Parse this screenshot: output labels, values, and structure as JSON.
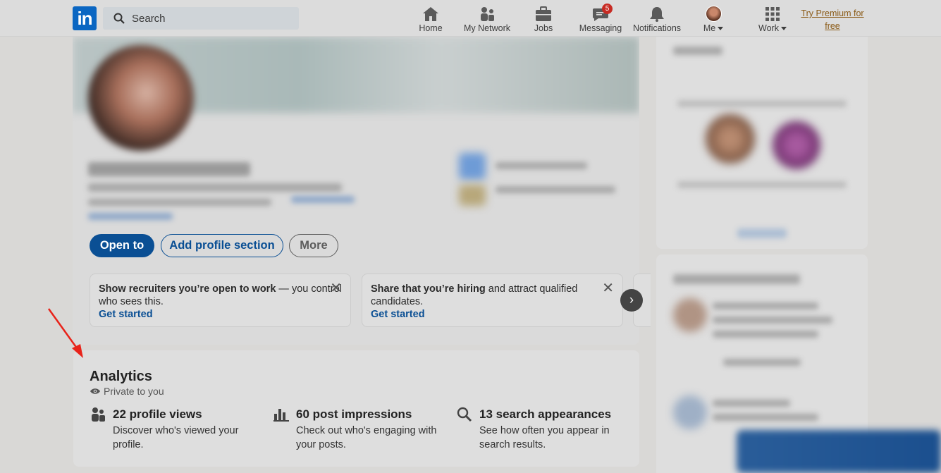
{
  "nav": {
    "logo_text": "in",
    "search_placeholder": "Search",
    "items": [
      {
        "label": "Home",
        "icon": "home-icon"
      },
      {
        "label": "My Network",
        "icon": "network-icon"
      },
      {
        "label": "Jobs",
        "icon": "briefcase-icon"
      },
      {
        "label": "Messaging",
        "icon": "messaging-icon",
        "badge": "5"
      },
      {
        "label": "Notifications",
        "icon": "bell-icon"
      },
      {
        "label": "Me",
        "icon": "avatar"
      },
      {
        "label": "Work",
        "icon": "grid-icon"
      }
    ],
    "premium_line1": "Try Premium for",
    "premium_line2": "free"
  },
  "profile": {
    "buttons": {
      "open_to": "Open to",
      "add_section": "Add profile section",
      "more": "More"
    },
    "suggestions": [
      {
        "bold": "Show recruiters you’re open to work",
        "rest": " — you control who sees this.",
        "link": "Get started"
      },
      {
        "bold": "Share that you’re hiring",
        "rest": " and attract qualified candidates.",
        "link": "Get started"
      }
    ]
  },
  "analytics": {
    "title": "Analytics",
    "privacy": "Private to you",
    "metrics": [
      {
        "icon": "people-icon",
        "title": "22 profile views",
        "desc": "Discover who's viewed your profile."
      },
      {
        "icon": "bar-chart-icon",
        "title": "60 post impressions",
        "desc": "Check out who's engaging with your posts."
      },
      {
        "icon": "search-icon",
        "title": "13 search appearances",
        "desc": "See how often you appear in search results."
      }
    ]
  },
  "colors": {
    "brand": "#0a66c2",
    "primary_button": "#0a4f94",
    "badge": "#c72b23",
    "annotation_arrow": "#e8231a"
  }
}
